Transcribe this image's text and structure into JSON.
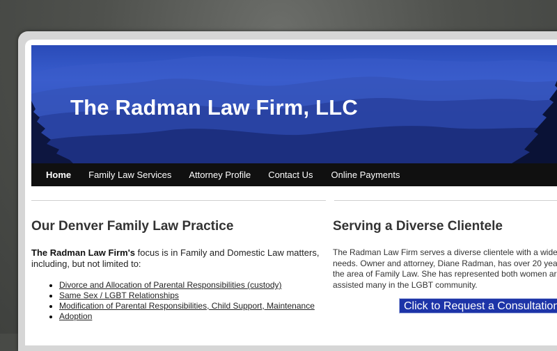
{
  "site": {
    "title": "The Radman Law Firm, LLC"
  },
  "nav": {
    "items": [
      {
        "label": "Home",
        "active": true
      },
      {
        "label": "Family Law Services"
      },
      {
        "label": "Attorney Profile"
      },
      {
        "label": "Contact Us"
      },
      {
        "label": "Online Payments"
      }
    ]
  },
  "left": {
    "heading": "Our Denver Family Law Practice",
    "intro_bold": "The Radman Law Firm's",
    "intro_rest": " focus is in Family and Domestic Law matters, including, but not limited to:",
    "services": [
      "Divorce and Allocation of Parental Responsibilities (custody)",
      "Same Sex / LGBT Relationships",
      "Modification of Parental Responsibilities, Child Support, Maintenance",
      "Adoption"
    ]
  },
  "right": {
    "heading": "Serving a Diverse Clientele",
    "lines": [
      "The Radman Law Firm serves a diverse clientele with a wide",
      "needs. Owner and attorney, Diane Radman, has over 20 yea",
      "the area of Family Law.  She has represented both women ar",
      "assisted many in the LGBT community."
    ],
    "cta_label": "Click to Request a Consultation"
  },
  "colors": {
    "nav_bg": "#101010",
    "header_blue": "#2f4fb8",
    "cta_bg": "#1d34a8"
  }
}
